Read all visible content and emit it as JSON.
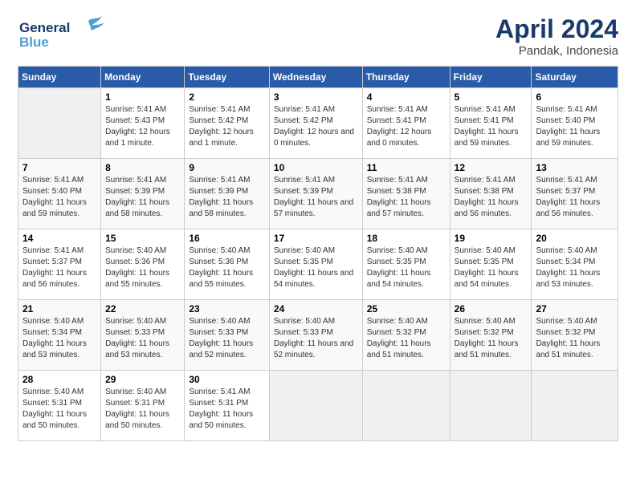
{
  "logo": {
    "line1": "General",
    "line2": "Blue"
  },
  "title": "April 2024",
  "subtitle": "Pandak, Indonesia",
  "columns": [
    "Sunday",
    "Monday",
    "Tuesday",
    "Wednesday",
    "Thursday",
    "Friday",
    "Saturday"
  ],
  "weeks": [
    [
      {
        "num": "",
        "sunrise": "",
        "sunset": "",
        "daylight": ""
      },
      {
        "num": "1",
        "sunrise": "Sunrise: 5:41 AM",
        "sunset": "Sunset: 5:43 PM",
        "daylight": "Daylight: 12 hours and 1 minute."
      },
      {
        "num": "2",
        "sunrise": "Sunrise: 5:41 AM",
        "sunset": "Sunset: 5:42 PM",
        "daylight": "Daylight: 12 hours and 1 minute."
      },
      {
        "num": "3",
        "sunrise": "Sunrise: 5:41 AM",
        "sunset": "Sunset: 5:42 PM",
        "daylight": "Daylight: 12 hours and 0 minutes."
      },
      {
        "num": "4",
        "sunrise": "Sunrise: 5:41 AM",
        "sunset": "Sunset: 5:41 PM",
        "daylight": "Daylight: 12 hours and 0 minutes."
      },
      {
        "num": "5",
        "sunrise": "Sunrise: 5:41 AM",
        "sunset": "Sunset: 5:41 PM",
        "daylight": "Daylight: 11 hours and 59 minutes."
      },
      {
        "num": "6",
        "sunrise": "Sunrise: 5:41 AM",
        "sunset": "Sunset: 5:40 PM",
        "daylight": "Daylight: 11 hours and 59 minutes."
      }
    ],
    [
      {
        "num": "7",
        "sunrise": "Sunrise: 5:41 AM",
        "sunset": "Sunset: 5:40 PM",
        "daylight": "Daylight: 11 hours and 59 minutes."
      },
      {
        "num": "8",
        "sunrise": "Sunrise: 5:41 AM",
        "sunset": "Sunset: 5:39 PM",
        "daylight": "Daylight: 11 hours and 58 minutes."
      },
      {
        "num": "9",
        "sunrise": "Sunrise: 5:41 AM",
        "sunset": "Sunset: 5:39 PM",
        "daylight": "Daylight: 11 hours and 58 minutes."
      },
      {
        "num": "10",
        "sunrise": "Sunrise: 5:41 AM",
        "sunset": "Sunset: 5:39 PM",
        "daylight": "Daylight: 11 hours and 57 minutes."
      },
      {
        "num": "11",
        "sunrise": "Sunrise: 5:41 AM",
        "sunset": "Sunset: 5:38 PM",
        "daylight": "Daylight: 11 hours and 57 minutes."
      },
      {
        "num": "12",
        "sunrise": "Sunrise: 5:41 AM",
        "sunset": "Sunset: 5:38 PM",
        "daylight": "Daylight: 11 hours and 56 minutes."
      },
      {
        "num": "13",
        "sunrise": "Sunrise: 5:41 AM",
        "sunset": "Sunset: 5:37 PM",
        "daylight": "Daylight: 11 hours and 56 minutes."
      }
    ],
    [
      {
        "num": "14",
        "sunrise": "Sunrise: 5:41 AM",
        "sunset": "Sunset: 5:37 PM",
        "daylight": "Daylight: 11 hours and 56 minutes."
      },
      {
        "num": "15",
        "sunrise": "Sunrise: 5:40 AM",
        "sunset": "Sunset: 5:36 PM",
        "daylight": "Daylight: 11 hours and 55 minutes."
      },
      {
        "num": "16",
        "sunrise": "Sunrise: 5:40 AM",
        "sunset": "Sunset: 5:36 PM",
        "daylight": "Daylight: 11 hours and 55 minutes."
      },
      {
        "num": "17",
        "sunrise": "Sunrise: 5:40 AM",
        "sunset": "Sunset: 5:35 PM",
        "daylight": "Daylight: 11 hours and 54 minutes."
      },
      {
        "num": "18",
        "sunrise": "Sunrise: 5:40 AM",
        "sunset": "Sunset: 5:35 PM",
        "daylight": "Daylight: 11 hours and 54 minutes."
      },
      {
        "num": "19",
        "sunrise": "Sunrise: 5:40 AM",
        "sunset": "Sunset: 5:35 PM",
        "daylight": "Daylight: 11 hours and 54 minutes."
      },
      {
        "num": "20",
        "sunrise": "Sunrise: 5:40 AM",
        "sunset": "Sunset: 5:34 PM",
        "daylight": "Daylight: 11 hours and 53 minutes."
      }
    ],
    [
      {
        "num": "21",
        "sunrise": "Sunrise: 5:40 AM",
        "sunset": "Sunset: 5:34 PM",
        "daylight": "Daylight: 11 hours and 53 minutes."
      },
      {
        "num": "22",
        "sunrise": "Sunrise: 5:40 AM",
        "sunset": "Sunset: 5:33 PM",
        "daylight": "Daylight: 11 hours and 53 minutes."
      },
      {
        "num": "23",
        "sunrise": "Sunrise: 5:40 AM",
        "sunset": "Sunset: 5:33 PM",
        "daylight": "Daylight: 11 hours and 52 minutes."
      },
      {
        "num": "24",
        "sunrise": "Sunrise: 5:40 AM",
        "sunset": "Sunset: 5:33 PM",
        "daylight": "Daylight: 11 hours and 52 minutes."
      },
      {
        "num": "25",
        "sunrise": "Sunrise: 5:40 AM",
        "sunset": "Sunset: 5:32 PM",
        "daylight": "Daylight: 11 hours and 51 minutes."
      },
      {
        "num": "26",
        "sunrise": "Sunrise: 5:40 AM",
        "sunset": "Sunset: 5:32 PM",
        "daylight": "Daylight: 11 hours and 51 minutes."
      },
      {
        "num": "27",
        "sunrise": "Sunrise: 5:40 AM",
        "sunset": "Sunset: 5:32 PM",
        "daylight": "Daylight: 11 hours and 51 minutes."
      }
    ],
    [
      {
        "num": "28",
        "sunrise": "Sunrise: 5:40 AM",
        "sunset": "Sunset: 5:31 PM",
        "daylight": "Daylight: 11 hours and 50 minutes."
      },
      {
        "num": "29",
        "sunrise": "Sunrise: 5:40 AM",
        "sunset": "Sunset: 5:31 PM",
        "daylight": "Daylight: 11 hours and 50 minutes."
      },
      {
        "num": "30",
        "sunrise": "Sunrise: 5:41 AM",
        "sunset": "Sunset: 5:31 PM",
        "daylight": "Daylight: 11 hours and 50 minutes."
      },
      {
        "num": "",
        "sunrise": "",
        "sunset": "",
        "daylight": ""
      },
      {
        "num": "",
        "sunrise": "",
        "sunset": "",
        "daylight": ""
      },
      {
        "num": "",
        "sunrise": "",
        "sunset": "",
        "daylight": ""
      },
      {
        "num": "",
        "sunrise": "",
        "sunset": "",
        "daylight": ""
      }
    ]
  ]
}
